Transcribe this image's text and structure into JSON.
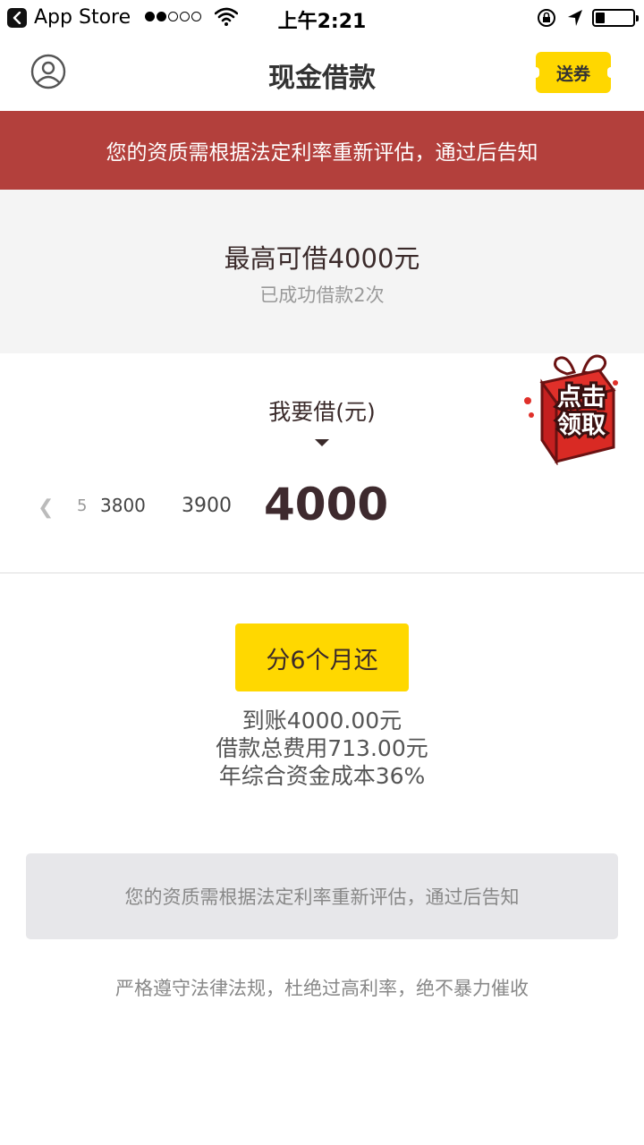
{
  "status_bar": {
    "app_name": "App Store",
    "time": "上午2:21",
    "battery_level": 0.2
  },
  "nav": {
    "title": "现金借款",
    "coupon_label": "送券",
    "user_icon": "user-circle-icon"
  },
  "alert": {
    "message": "您的资质需根据法定利率重新评估，通过后告知"
  },
  "limit": {
    "max_text": "最高可借4000元",
    "count_text": "已成功借款2次"
  },
  "borrow": {
    "label": "我要借(元)",
    "amounts": [
      "3800",
      "3900",
      "4000"
    ],
    "selected": "4000",
    "tick_small": "5"
  },
  "gift": {
    "label_line1": "点击",
    "label_line2": "领取"
  },
  "installment": {
    "button_label": "分6个月还",
    "details": [
      "到账4000.00元",
      "借款总费用713.00元",
      "年综合资金成本36%"
    ]
  },
  "notice": {
    "message": "您的资质需根据法定利率重新评估，通过后告知"
  },
  "footer": {
    "text": "严格遵守法律法规，杜绝过高利率，绝不暴力催收"
  },
  "colors": {
    "alert_red": "#b3403c",
    "accent_yellow": "#ffd800",
    "gray_bg": "#f4f4f4"
  }
}
